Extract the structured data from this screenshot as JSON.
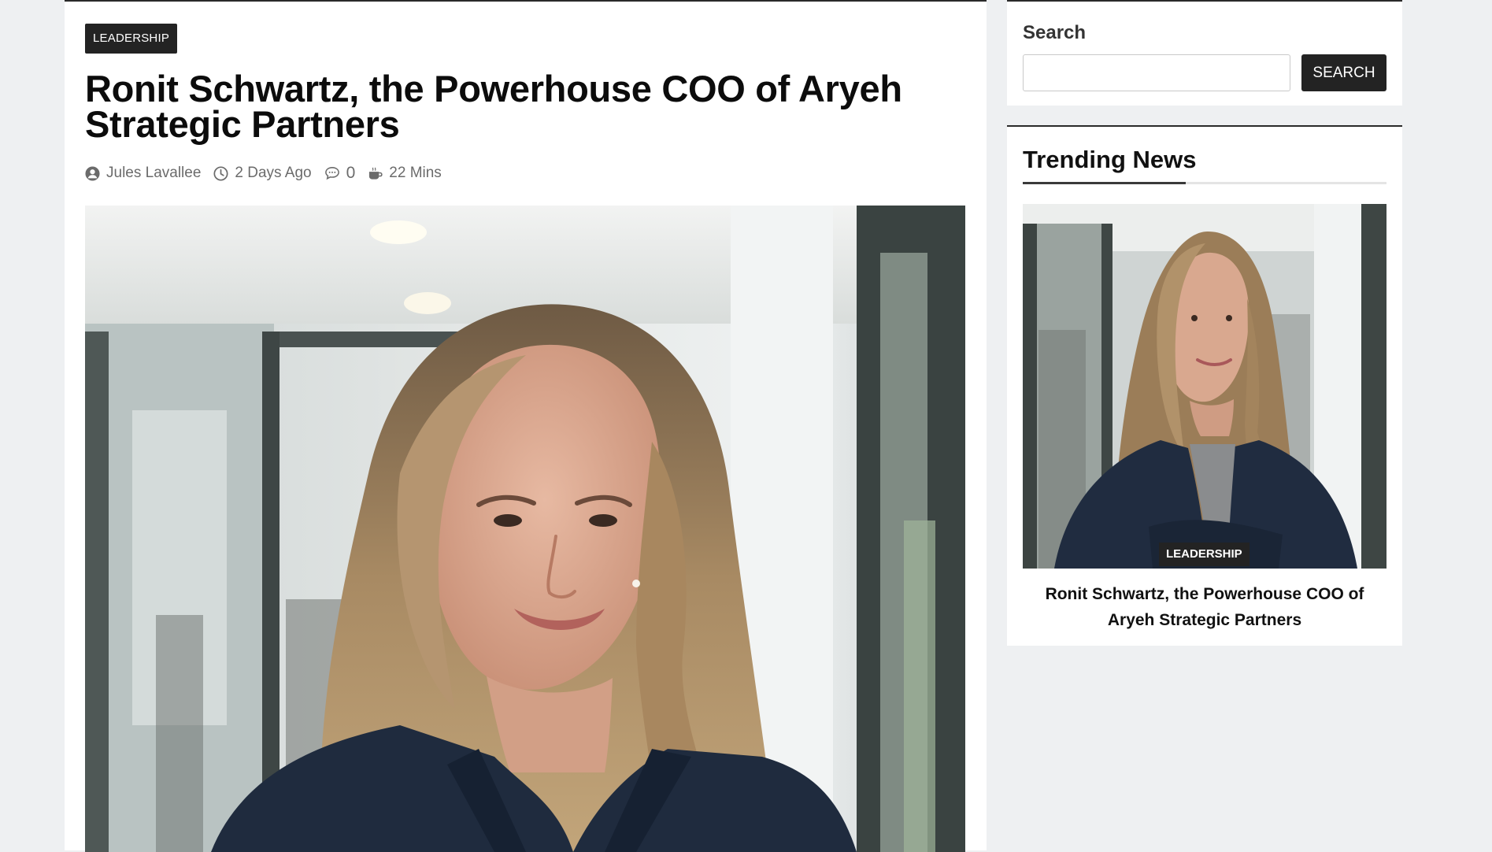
{
  "article": {
    "category": "LEADERSHIP",
    "title": "Ronit Schwartz, the Powerhouse COO of Aryeh Strategic Partners",
    "meta": {
      "author": "Jules Lavallee",
      "date": "2 Days Ago",
      "comments": "0",
      "read_time": "22 Mins"
    }
  },
  "sidebar": {
    "search": {
      "title": "Search",
      "input_value": "",
      "button_label": "SEARCH"
    },
    "trending": {
      "title": "Trending News",
      "item": {
        "category": "LEADERSHIP",
        "headline": "Ronit Schwartz, the Powerhouse COO of Aryeh Strategic Partners"
      }
    }
  },
  "icons": {
    "author": "user-circle-icon",
    "date": "clock-icon",
    "comments": "comment-bubble-icon",
    "read_time": "coffee-cup-icon"
  },
  "colors": {
    "page_background": "#eef0f2",
    "card_background": "#ffffff",
    "badge_background": "#232323",
    "badge_text": "#ffffff",
    "title_text": "#0c0c0c",
    "meta_text": "#6b6b6b"
  }
}
